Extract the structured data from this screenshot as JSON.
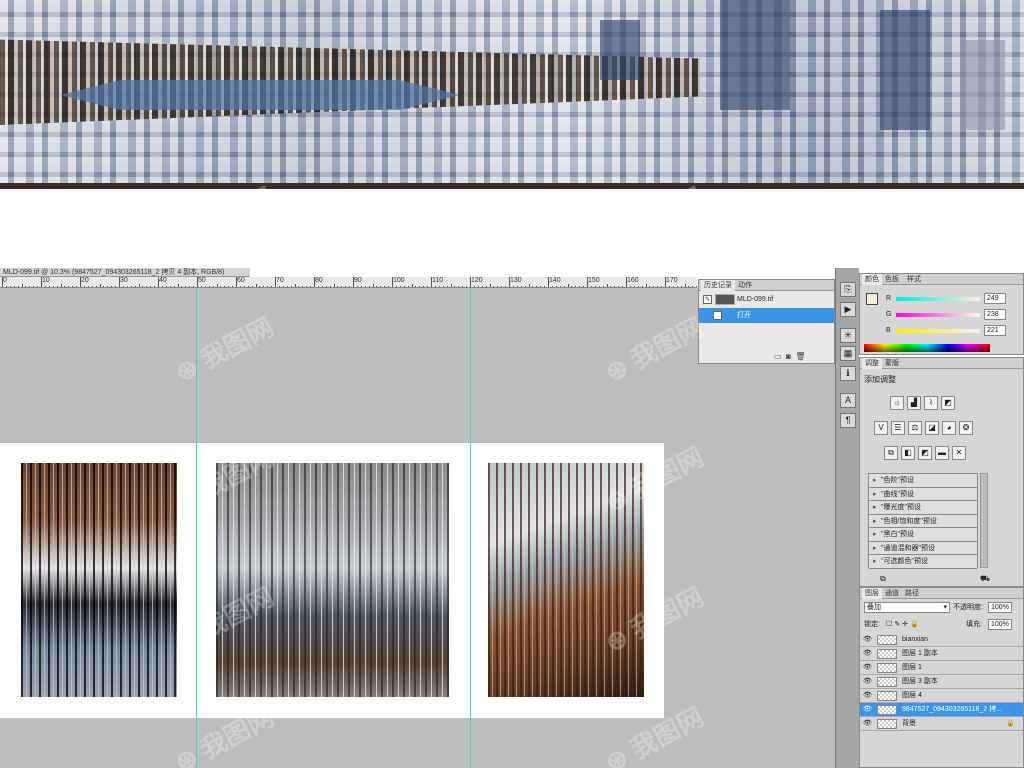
{
  "document": {
    "tab_title": "MLD-099.tif @ 10.3% (9847527_094303265118_2 拷贝 4 副本, RGB/8)"
  },
  "ruler": {
    "labels": [
      "0",
      "10",
      "20",
      "30",
      "40",
      "50",
      "60",
      "70",
      "80",
      "90",
      "100",
      "110",
      "120",
      "130",
      "140",
      "150",
      "160",
      "170"
    ]
  },
  "history_panel": {
    "tabs": [
      "历史记录",
      "动作"
    ],
    "snapshot": "MLD-099.tif",
    "items": [
      {
        "label": "打开"
      }
    ]
  },
  "color_panel": {
    "tabs": [
      "颜色",
      "色板",
      "样式"
    ],
    "foreground": "#f9eedd",
    "channels": [
      {
        "label": "R",
        "value": "249",
        "gradient": "linear-gradient(90deg,#00eedd,#ffeedd)"
      },
      {
        "label": "G",
        "value": "238",
        "gradient": "linear-gradient(90deg,#f900dd,#f9ffdd)"
      },
      {
        "label": "B",
        "value": "221",
        "gradient": "linear-gradient(90deg,#f9ee00,#f9eeff)"
      }
    ]
  },
  "adjustments_panel": {
    "tabs": [
      "调整",
      "蒙版"
    ],
    "title": "添加调整",
    "presets": [
      "\"色阶\"预设",
      "\"曲线\"预设",
      "\"曝光度\"预设",
      "\"色相/饱和度\"预设",
      "\"黑白\"预设",
      "\"通道混和器\"预设",
      "\"可选颜色\"预设"
    ]
  },
  "layers_panel": {
    "tabs": [
      "图层",
      "通道",
      "路径"
    ],
    "blend_mode": "叠加",
    "opacity_label": "不透明度:",
    "opacity_value": "100%",
    "lock_label": "锁定:",
    "fill_label": "填充:",
    "fill_value": "100%",
    "layers": [
      {
        "name": "bianxian",
        "selected": false
      },
      {
        "name": "图层 1 副本",
        "selected": false
      },
      {
        "name": "图层 1",
        "selected": false
      },
      {
        "name": "图层 3 副本",
        "selected": false
      },
      {
        "name": "图层 4",
        "selected": false
      },
      {
        "name": "9847527_094303265118_2 拷...",
        "selected": true
      },
      {
        "name": "背景",
        "selected": false
      }
    ]
  },
  "colors": {
    "selection": "#3a95e8",
    "guide": "#4fc9d4",
    "canvas_bg": "#bdbdbd"
  }
}
